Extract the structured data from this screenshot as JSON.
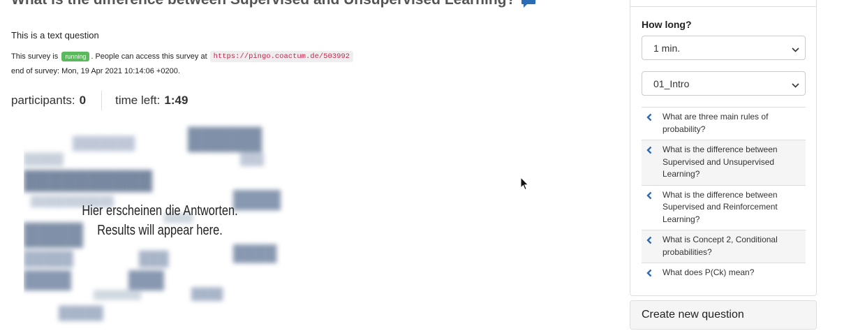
{
  "question": {
    "title": "What is the difference between Supervised and Unsupervised Learning?",
    "type_text": "This is a text question",
    "comment_icon": "comment-icon"
  },
  "survey": {
    "status_prefix": "This survey is",
    "status_badge": "running",
    "status_suffix": ". People can access this survey at",
    "url": "https://pingo.coactum.de/503992",
    "end_text": "end of survey: Mon, 19 Apr 2021 10:14:06 +0200."
  },
  "stats": {
    "participants_label": "participants:",
    "participants_value": "0",
    "time_left_label": "time left:",
    "time_left_value": "1:49"
  },
  "results_placeholder": {
    "line1": "Hier erscheinen die Antworten.",
    "line2": "Results will appear here."
  },
  "sidebar": {
    "how_long_label": "How long?",
    "duration_selected": "1 min.",
    "tag_selected": "01_Intro",
    "questions": [
      {
        "text": "What are three main rules of probability?",
        "icon": "chevron-left-icon"
      },
      {
        "text": "What is the difference between Supervised and Unsupervised Learning?",
        "icon": "chevron-left-icon"
      },
      {
        "text": "What is the difference between Supervised and Reinforcement Learning?",
        "icon": "chevron-left-icon"
      },
      {
        "text": "What is Concept 2, Conditional probabilities?",
        "icon": "chevron-left-icon"
      },
      {
        "text": "What does P(Ck) mean?",
        "icon": "chevron-left-icon"
      }
    ],
    "create_button": "Create new question"
  },
  "colors": {
    "accent_blue": "#2a6cb5",
    "badge_green": "#5cb85c",
    "code_red": "#c7254e"
  }
}
